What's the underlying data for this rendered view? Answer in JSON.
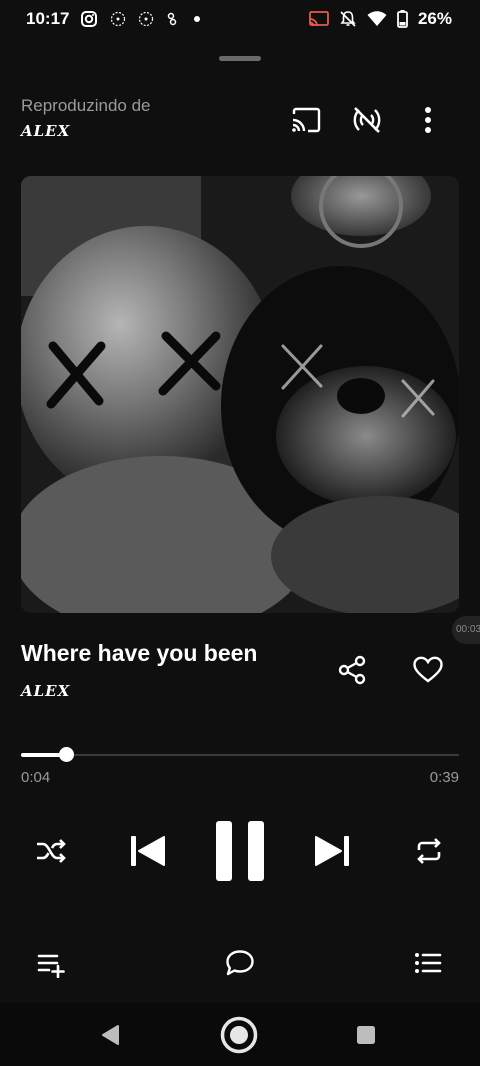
{
  "status_bar": {
    "time": "10:17",
    "battery": "26%",
    "icons_left": [
      "instagram-icon",
      "app-icon",
      "app-icon",
      "app-icon",
      "dot-icon"
    ],
    "icons_right": [
      "cast-icon",
      "mute-icon",
      "wifi-icon",
      "battery-icon"
    ]
  },
  "header": {
    "playing_from_label": "Reproduzindo de",
    "source_name": "ALEX"
  },
  "track": {
    "title": "Where have you been",
    "artist": "ALEX"
  },
  "side_time": "00:03",
  "progress": {
    "current": "0:04",
    "total": "0:39",
    "fraction": 0.103
  },
  "colors": {
    "background": "#0f0f0f",
    "secondary_text": "#9a9a9a",
    "track": "#3a3a3a",
    "accent": "#ffffff"
  }
}
